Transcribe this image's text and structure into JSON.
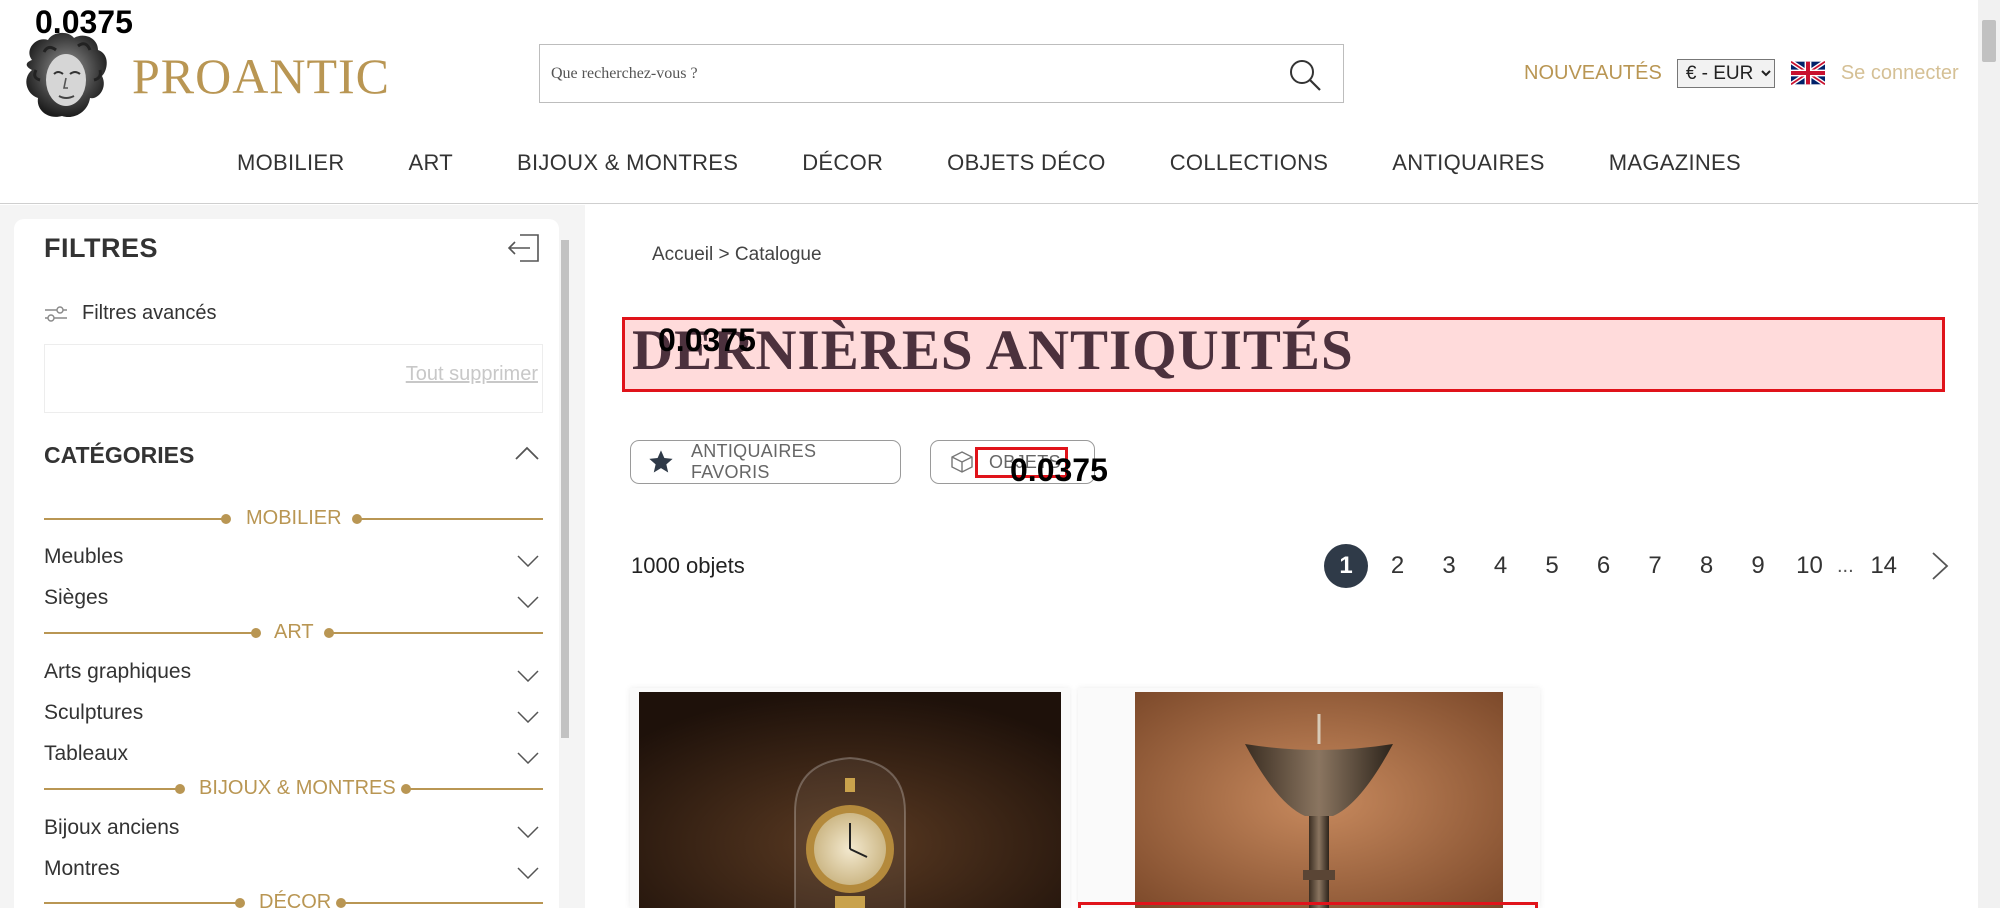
{
  "overlay_values": {
    "top_left": "0.0375",
    "title": "0.0375",
    "pill": "0.0375"
  },
  "header": {
    "logo_text": "PROANTIC",
    "search_placeholder": "Que recherchez-vous ?",
    "nouveautes": "NOUVEAUTÉS",
    "currency": "€ - EUR",
    "login": "Se connecter"
  },
  "nav": [
    "MOBILIER",
    "ART",
    "BIJOUX & MONTRES",
    "DÉCOR",
    "OBJETS DÉCO",
    "COLLECTIONS",
    "ANTIQUAIRES",
    "MAGAZINES"
  ],
  "sidebar": {
    "title": "FILTRES",
    "advanced": "Filtres avancés",
    "clear_all": "Tout supprimer",
    "categories_title": "CATÉGORIES",
    "groups": [
      {
        "label": "MOBILIER",
        "items": [
          "Meubles",
          "Sièges"
        ]
      },
      {
        "label": "ART",
        "items": [
          "Arts graphiques",
          "Sculptures",
          "Tableaux"
        ]
      },
      {
        "label": "BIJOUX & MONTRES",
        "items": [
          "Bijoux anciens",
          "Montres"
        ]
      },
      {
        "label": "DÉCOR",
        "items": []
      }
    ]
  },
  "main": {
    "breadcrumb_home": "Accueil",
    "breadcrumb_sep": ">",
    "breadcrumb_current": "Catalogue",
    "title": "DERNIÈRES ANTIQUITÉS",
    "pill_favorites": "ANTIQUAIRES FAVORIS",
    "pill_objects": "OBJETS",
    "count": "1000 objets",
    "pages": [
      "1",
      "2",
      "3",
      "4",
      "5",
      "6",
      "7",
      "8",
      "9",
      "10"
    ],
    "ellipsis": "...",
    "last_page": "14"
  },
  "colors": {
    "gold": "#b99653",
    "navy": "#2f3a48",
    "highlight_red": "#e0131a"
  }
}
